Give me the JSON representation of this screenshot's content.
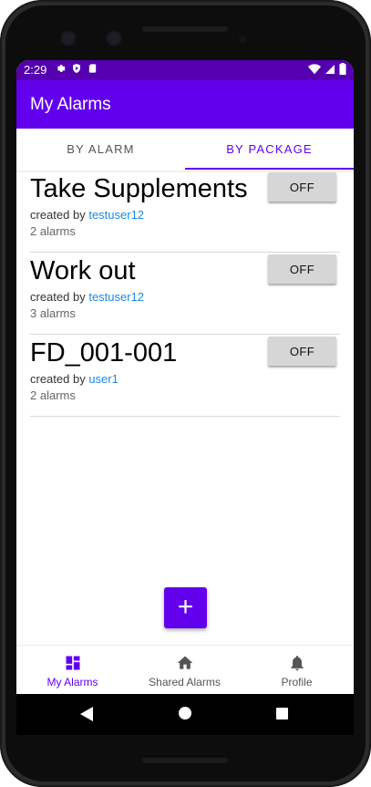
{
  "status_bar": {
    "time": "2:29"
  },
  "app_bar": {
    "title": "My Alarms"
  },
  "tabs": [
    {
      "label": "BY ALARM",
      "selected": false
    },
    {
      "label": "BY PACKAGE",
      "selected": true
    }
  ],
  "packages": [
    {
      "title": "Take Supplements",
      "created_prefix": "created by",
      "creator": "testuser12",
      "alarm_count": "2 alarms",
      "toggle_label": "OFF"
    },
    {
      "title": "Work out",
      "created_prefix": "created by",
      "creator": "testuser12",
      "alarm_count": "3 alarms",
      "toggle_label": "OFF"
    },
    {
      "title": "FD_001-001",
      "created_prefix": "created by",
      "creator": "user1",
      "alarm_count": "2 alarms",
      "toggle_label": "OFF"
    }
  ],
  "fab": {
    "label": "+"
  },
  "bottom_nav": [
    {
      "label": "My Alarms",
      "icon": "dashboard-icon",
      "selected": true
    },
    {
      "label": "Shared Alarms",
      "icon": "home-icon",
      "selected": false
    },
    {
      "label": "Profile",
      "icon": "bell-icon",
      "selected": false
    }
  ],
  "colors": {
    "primary": "#6200ee",
    "status_bar": "#5500b0",
    "link": "#1e88e5"
  }
}
